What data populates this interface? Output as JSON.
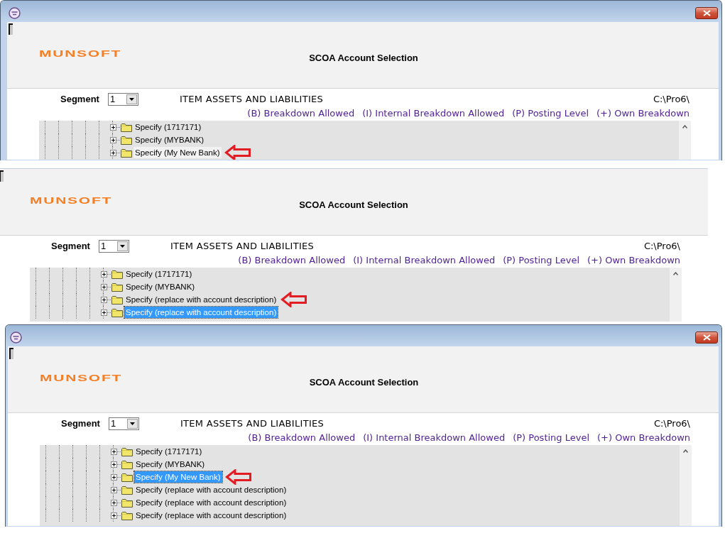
{
  "panels": [
    {
      "kind": "window",
      "logo": "MUNSOFT",
      "title": "SCOA Account Selection",
      "segment": {
        "label": "Segment",
        "value": "1"
      },
      "heading": "ITEM ASSETS AND LIABILITIES",
      "path": "C:\\Pro6\\",
      "legend": [
        "(B) Breakdown Allowed",
        "(I) Internal Breakdown Allowed",
        "(P) Posting Level",
        "(+) Own Breakdown"
      ],
      "tree": {
        "focused": false,
        "items": [
          {
            "label": "Specify (1717171)",
            "expanded": false,
            "selected": false
          },
          {
            "label": "Specify (MYBANK)",
            "expanded": false,
            "selected": false
          },
          {
            "label": "Specify (My New Bank)",
            "expanded": false,
            "selected": true,
            "annotated": true
          }
        ]
      }
    },
    {
      "kind": "pane",
      "logo": "MUNSOFT",
      "title": "SCOA Account Selection",
      "segment": {
        "label": "Segment",
        "value": "1"
      },
      "heading": "ITEM ASSETS AND LIABILITIES",
      "path": "C:\\Pro6\\",
      "legend": [
        "(B) Breakdown Allowed",
        "(I) Internal Breakdown Allowed",
        "(P) Posting Level",
        "(+) Own Breakdown"
      ],
      "tree": {
        "focused": true,
        "items": [
          {
            "label": "Specify (1717171)",
            "expanded": false,
            "selected": false
          },
          {
            "label": "Specify (MYBANK)",
            "expanded": false,
            "selected": false
          },
          {
            "label": "Specify (replace with account description)",
            "expanded": false,
            "selected": false,
            "annotated": true
          },
          {
            "label": "Specify (replace with account description)",
            "expanded": false,
            "selected": true
          }
        ]
      }
    },
    {
      "kind": "window",
      "logo": "MUNSOFT",
      "title": "SCOA Account Selection",
      "segment": {
        "label": "Segment",
        "value": "1"
      },
      "heading": "ITEM ASSETS AND LIABILITIES",
      "path": "C:\\Pro6\\",
      "legend": [
        "(B) Breakdown Allowed",
        "(I) Internal Breakdown Allowed",
        "(P) Posting Level",
        "(+) Own Breakdown"
      ],
      "tree": {
        "focused": true,
        "items": [
          {
            "label": "Specify (1717171)",
            "expanded": false,
            "selected": false
          },
          {
            "label": "Specify (MYBANK)",
            "expanded": false,
            "selected": false
          },
          {
            "label": "Specify (My New Bank)",
            "expanded": false,
            "selected": true,
            "annotated": true
          },
          {
            "label": "Specify (replace with account description)",
            "expanded": false,
            "selected": false
          },
          {
            "label": "Specify (replace with account description)",
            "expanded": false,
            "selected": false
          },
          {
            "label": "Specify (replace with account description)",
            "expanded": false,
            "selected": false
          }
        ]
      }
    }
  ]
}
